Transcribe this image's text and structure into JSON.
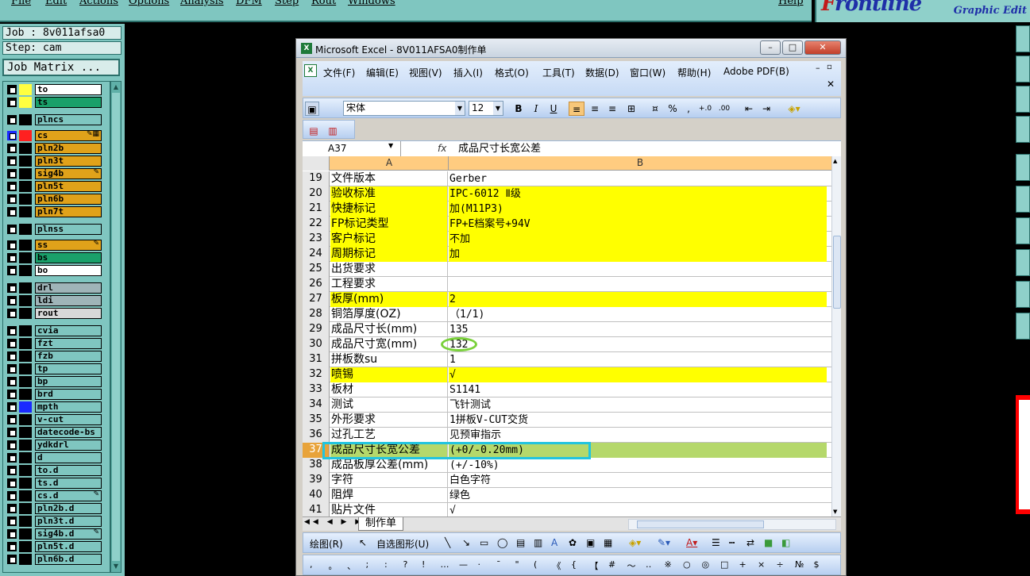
{
  "frontline_menu": [
    "File",
    "Edit",
    "Actions",
    "Options",
    "Analysis",
    "DFM",
    "Step",
    "Rout",
    "Windows",
    "Help"
  ],
  "logo": {
    "brand_prefix": "F",
    "brand_rest": "rontline",
    "subtitle": "Graphic Edit"
  },
  "job": {
    "job_label": "Job : 8v011afsa0",
    "step_label": "Step: cam",
    "matrix_button": "Job Matrix ..."
  },
  "layers": [
    {
      "name": "to",
      "swatch": "#ffff40",
      "fill": "#ffffff",
      "mark": ""
    },
    {
      "name": "ts",
      "swatch": "#ffff40",
      "fill": "#1aa06a",
      "mark": ""
    },
    {
      "name": "plncs",
      "swatch": "#000000",
      "fill": "#7fc6c0",
      "mark": ""
    },
    {
      "name": "cs",
      "swatch": "#ff2020",
      "fill": "#e0a21a",
      "mark": "✎▦",
      "active": true
    },
    {
      "name": "pln2b",
      "swatch": "#000000",
      "fill": "#e0a21a",
      "mark": ""
    },
    {
      "name": "pln3t",
      "swatch": "#000000",
      "fill": "#e0a21a",
      "mark": ""
    },
    {
      "name": "sig4b",
      "swatch": "#000000",
      "fill": "#e0a21a",
      "mark": "✎"
    },
    {
      "name": "pln5t",
      "swatch": "#000000",
      "fill": "#e0a21a",
      "mark": ""
    },
    {
      "name": "pln6b",
      "swatch": "#000000",
      "fill": "#e0a21a",
      "mark": ""
    },
    {
      "name": "pln7t",
      "swatch": "#000000",
      "fill": "#e0a21a",
      "mark": ""
    },
    {
      "name": "plnss",
      "swatch": "#000000",
      "fill": "#7fc6c0",
      "mark": ""
    },
    {
      "name": "ss",
      "swatch": "#000000",
      "fill": "#e0a21a",
      "mark": "✎"
    },
    {
      "name": "bs",
      "swatch": "#000000",
      "fill": "#1aa06a",
      "mark": ""
    },
    {
      "name": "bo",
      "swatch": "#000000",
      "fill": "#ffffff",
      "mark": ""
    },
    {
      "name": "drl",
      "swatch": "#000000",
      "fill": "#9fb4b8",
      "mark": ""
    },
    {
      "name": "ldi",
      "swatch": "#000000",
      "fill": "#9fb4b8",
      "mark": ""
    },
    {
      "name": "rout",
      "swatch": "#000000",
      "fill": "#d8d8d8",
      "mark": ""
    },
    {
      "name": "cvia",
      "swatch": "#000000",
      "fill": "#7fc6c0",
      "mark": ""
    },
    {
      "name": "fzt",
      "swatch": "#000000",
      "fill": "#7fc6c0",
      "mark": ""
    },
    {
      "name": "fzb",
      "swatch": "#000000",
      "fill": "#7fc6c0",
      "mark": ""
    },
    {
      "name": "tp",
      "swatch": "#000000",
      "fill": "#7fc6c0",
      "mark": ""
    },
    {
      "name": "bp",
      "swatch": "#000000",
      "fill": "#7fc6c0",
      "mark": ""
    },
    {
      "name": "brd",
      "swatch": "#000000",
      "fill": "#7fc6c0",
      "mark": ""
    },
    {
      "name": "mpth",
      "swatch": "#1a2aff",
      "fill": "#7fc6c0",
      "mark": ""
    },
    {
      "name": "v-cut",
      "swatch": "#000000",
      "fill": "#7fc6c0",
      "mark": ""
    },
    {
      "name": "datecode-bs",
      "swatch": "#000000",
      "fill": "#7fc6c0",
      "mark": ""
    },
    {
      "name": "ydkdrl",
      "swatch": "#000000",
      "fill": "#7fc6c0",
      "mark": ""
    },
    {
      "name": "d",
      "swatch": "#000000",
      "fill": "#7fc6c0",
      "mark": ""
    },
    {
      "name": "to.d",
      "swatch": "#000000",
      "fill": "#7fc6c0",
      "mark": ""
    },
    {
      "name": "ts.d",
      "swatch": "#000000",
      "fill": "#7fc6c0",
      "mark": ""
    },
    {
      "name": "cs.d",
      "swatch": "#000000",
      "fill": "#7fc6c0",
      "mark": "✎"
    },
    {
      "name": "pln2b.d",
      "swatch": "#000000",
      "fill": "#7fc6c0",
      "mark": ""
    },
    {
      "name": "pln3t.d",
      "swatch": "#000000",
      "fill": "#7fc6c0",
      "mark": ""
    },
    {
      "name": "sig4b.d",
      "swatch": "#000000",
      "fill": "#7fc6c0",
      "mark": "✎"
    },
    {
      "name": "pln5t.d",
      "swatch": "#000000",
      "fill": "#7fc6c0",
      "mark": ""
    },
    {
      "name": "pln6b.d",
      "swatch": "#000000",
      "fill": "#7fc6c0",
      "mark": ""
    }
  ],
  "excel": {
    "title": "Microsoft Excel - 8V011AFSA0制作单",
    "menus": [
      "文件(F)",
      "编辑(E)",
      "视图(V)",
      "插入(I)",
      "格式(O)",
      "工具(T)",
      "数据(D)",
      "窗口(W)",
      "帮助(H)",
      "Adobe PDF(B)"
    ],
    "font_name": "宋体",
    "font_size": "12",
    "name_box": "A37",
    "fx_label": "fx",
    "formula_value": "成品尺寸长宽公差",
    "col_a": "A",
    "col_b": "B",
    "rows": [
      {
        "n": "19",
        "a": "文件版本",
        "b": "Gerber",
        "style": ""
      },
      {
        "n": "20",
        "a": "验收标准",
        "b": "IPC-6012 Ⅱ级",
        "style": "yellow"
      },
      {
        "n": "21",
        "a": "快捷标记",
        "b": "加(M11P3)",
        "style": "yellow"
      },
      {
        "n": "22",
        "a": "FP标记类型",
        "b": "FP+E档案号+94V",
        "style": "yellow"
      },
      {
        "n": "23",
        "a": "客户标记",
        "b": "不加",
        "style": "yellow"
      },
      {
        "n": "24",
        "a": "周期标记",
        "b": "加",
        "style": "yellow"
      },
      {
        "n": "25",
        "a": "出货要求",
        "b": "",
        "style": ""
      },
      {
        "n": "26",
        "a": "工程要求",
        "b": "",
        "style": ""
      },
      {
        "n": "27",
        "a": "板厚(mm)",
        "b": "2",
        "style": "yellow"
      },
      {
        "n": "28",
        "a": "铜箔厚度(OZ)",
        "b": "（1/1)",
        "style": ""
      },
      {
        "n": "29",
        "a": "成品尺寸长(mm)",
        "b": "135",
        "style": ""
      },
      {
        "n": "30",
        "a": "成品尺寸宽(mm)",
        "b": "132",
        "style": ""
      },
      {
        "n": "31",
        "a": "拼板数su",
        "b": "1",
        "style": ""
      },
      {
        "n": "32",
        "a": "喷锡",
        "b": "√",
        "style": "yellow"
      },
      {
        "n": "33",
        "a": "板材",
        "b": "S1141",
        "style": ""
      },
      {
        "n": "34",
        "a": "测试",
        "b": "飞针测试",
        "style": ""
      },
      {
        "n": "35",
        "a": "外形要求",
        "b": "1拼板V-CUT交货",
        "style": ""
      },
      {
        "n": "36",
        "a": "过孔工艺",
        "b": "见预审指示",
        "style": ""
      },
      {
        "n": "37",
        "a": "成品尺寸长宽公差",
        "b": "(+0/-0.20mm)",
        "style": "sel"
      },
      {
        "n": "38",
        "a": "成品板厚公差(mm)",
        "b": "(+/-10%)",
        "style": ""
      },
      {
        "n": "39",
        "a": "字符",
        "b": "白色字符",
        "style": ""
      },
      {
        "n": "40",
        "a": "阻焊",
        "b": "绿色",
        "style": ""
      },
      {
        "n": "41",
        "a": "贴片文件",
        "b": "√",
        "style": ""
      }
    ],
    "sheet_tab": "制作单",
    "sheet_nav": "◀◀ ◀ ▶ ▶▶",
    "draw_label": "绘图(R)",
    "autoshape_label": "自选图形(U)",
    "symbols": [
      ",",
      "。",
      "、",
      ";",
      ":",
      "?",
      "!",
      "…",
      "—",
      "·",
      "ˉ",
      "\"",
      "(",
      "《",
      "{",
      "【",
      "#",
      "～",
      "‥",
      "※",
      "○",
      "◎",
      "□",
      "+",
      "×",
      "÷",
      "№",
      "$"
    ]
  },
  "colors": {
    "frontline_bg": "#7fc6c0",
    "excel_yellow": "#ffff00",
    "selection_row": "#b5d86b",
    "highlight_green": "#7ad13b",
    "highlight_cyan": "#22c4df"
  }
}
